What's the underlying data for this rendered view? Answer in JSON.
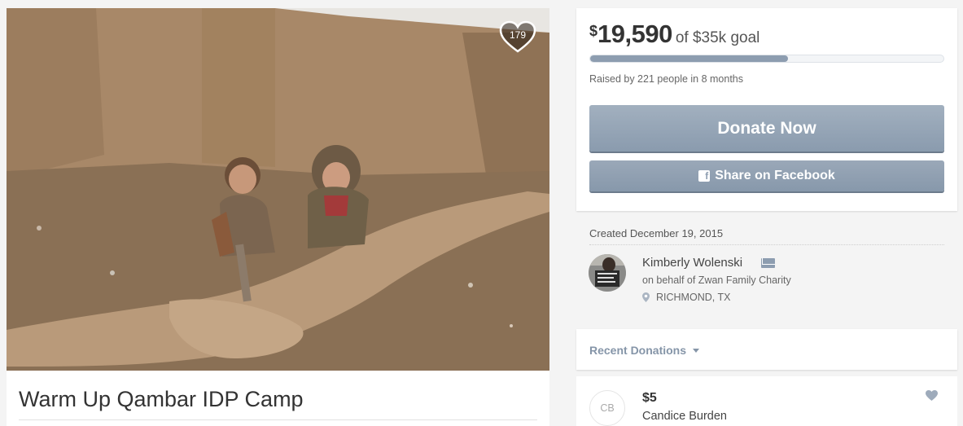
{
  "campaign": {
    "title": "Warm Up Qambar IDP Camp",
    "heart_count": "179"
  },
  "funding": {
    "currency_symbol": "$",
    "amount_raised": "19,590",
    "goal_text": "of $35k goal",
    "progress_fraction": 0.56,
    "raised_by_text": "Raised by 221 people in 8 months",
    "donate_label": "Donate Now",
    "share_label": "Share on Facebook"
  },
  "organizer": {
    "created_text": "Created December 19, 2015",
    "name": "Kimberly Wolenski",
    "behalf_text": "on behalf of Zwan Family Charity",
    "location": "RICHMOND, TX"
  },
  "recent": {
    "label": "Recent Donations"
  },
  "donations": [
    {
      "initials": "CB",
      "amount": "$5",
      "name": "Candice Burden"
    }
  ],
  "colors": {
    "accent": "#8d9db0",
    "button": "#8a9bae",
    "page_bg": "#f4f4f4"
  },
  "icons": {
    "heart": "heart-icon",
    "facebook": "facebook-icon",
    "mail": "mail-icon",
    "location": "map-pin-icon",
    "caret": "chevron-down-icon"
  }
}
